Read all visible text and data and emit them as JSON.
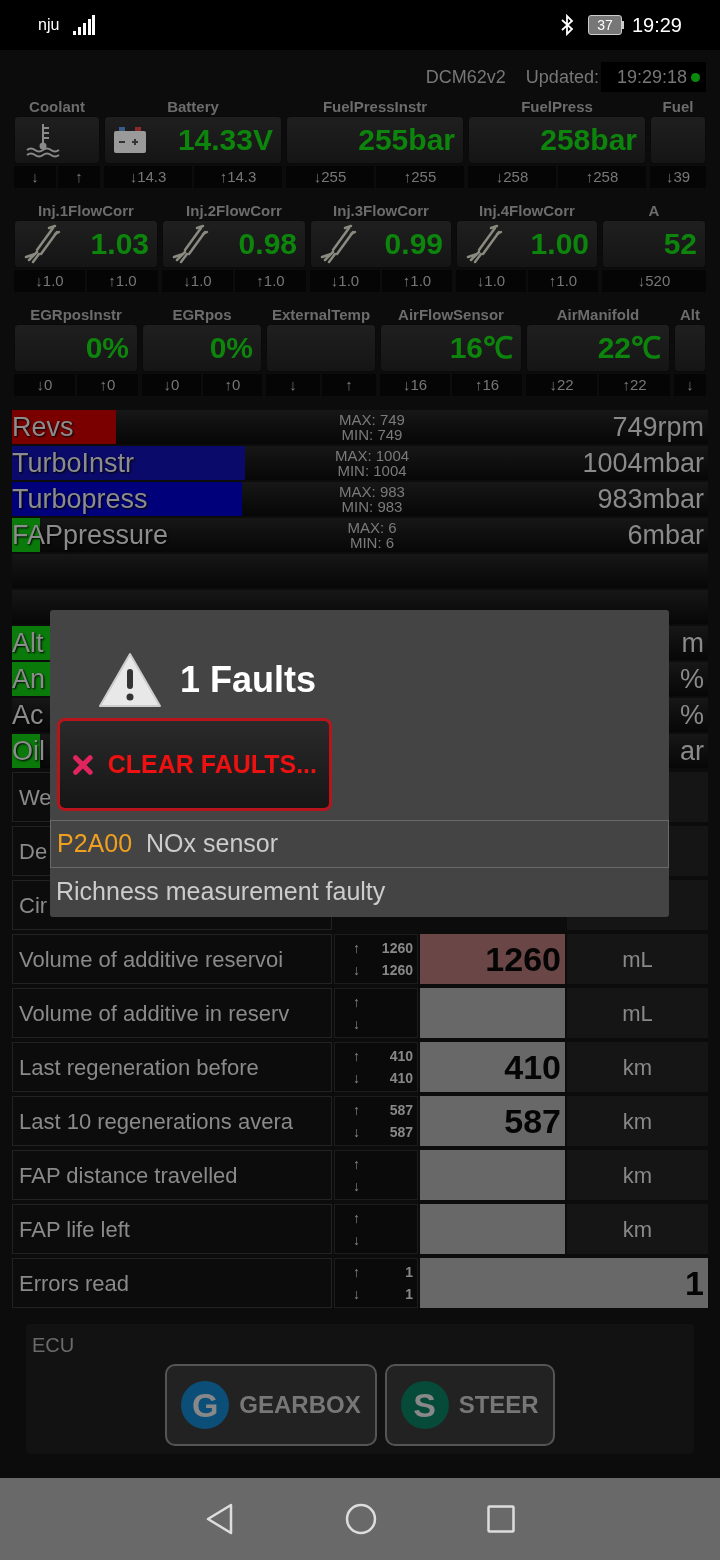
{
  "status_bar": {
    "carrier": "nju",
    "battery": "37",
    "time": "19:29"
  },
  "header": {
    "module": "DCM62v2",
    "updated_label": "Updated:",
    "updated_time": "19:29:18",
    "live": true
  },
  "gauge_rows": [
    {
      "gauges": [
        {
          "label": "Coolant",
          "kind": "thermometer",
          "min": "↓",
          "max": "↑"
        },
        {
          "label": "Battery",
          "kind": "battery",
          "value": "14.33V",
          "min": "↓14.3",
          "max": "↑14.3"
        },
        {
          "label": "FuelPressInstr",
          "value": "255bar",
          "min": "↓255",
          "max": "↑255"
        },
        {
          "label": "FuelPress",
          "value": "258bar",
          "min": "↓258",
          "max": "↑258"
        },
        {
          "label": "Fuel",
          "min": "↓39"
        }
      ]
    },
    {
      "gauges": [
        {
          "label": "Inj.1FlowCorr",
          "kind": "injector",
          "value": "1.03",
          "min": "↓1.0",
          "max": "↑1.0"
        },
        {
          "label": "Inj.2FlowCorr",
          "kind": "injector",
          "value": "0.98",
          "min": "↓1.0",
          "max": "↑1.0"
        },
        {
          "label": "Inj.3FlowCorr",
          "kind": "injector",
          "value": "0.99",
          "min": "↓1.0",
          "max": "↑1.0"
        },
        {
          "label": "Inj.4FlowCorr",
          "kind": "injector",
          "value": "1.00",
          "min": "↓1.0",
          "max": "↑1.0"
        },
        {
          "label": "A",
          "value": "52",
          "min": "↓520"
        }
      ]
    },
    {
      "gauges": [
        {
          "label": "EGRposInstr",
          "value": "0%",
          "min": "↓0",
          "max": "↑0"
        },
        {
          "label": "EGRpos",
          "value": "0%",
          "min": "↓0",
          "max": "↑0"
        },
        {
          "label": "ExternalTemp",
          "min": "↓",
          "max": "↑"
        },
        {
          "label": "AirFlowSensor",
          "value": "16℃",
          "min": "↓16",
          "max": "↑16"
        },
        {
          "label": "AirManifold",
          "value": "22℃",
          "min": "↓22",
          "max": "↑22"
        },
        {
          "label": "Alt",
          "min": "↓"
        }
      ]
    }
  ],
  "bars": [
    {
      "kind": "gauge",
      "label": "Revs",
      "level": 0.15,
      "color": "#7a0000",
      "max": "MAX: 749",
      "min": "MIN: 749",
      "value": "749rpm"
    },
    {
      "kind": "gauge",
      "label": "TurboInstr",
      "level": 0.335,
      "color": "#0a0a6a",
      "max": "MAX: 1004",
      "min": "MIN: 1004",
      "value": "1004mbar"
    },
    {
      "kind": "gauge",
      "label": "Turbopress",
      "level": 0.33,
      "color": "#00007a",
      "max": "MAX: 983",
      "min": "MIN: 983",
      "value": "983mbar"
    },
    {
      "kind": "gauge",
      "label": "FAPpressure",
      "level": 0.04,
      "color": "#0a7a0a",
      "max": "MAX: 6",
      "min": "MIN: 6",
      "value": "6mbar"
    },
    {
      "kind": "empty"
    },
    {
      "kind": "empty"
    },
    {
      "kind": "gauge",
      "label": "Alt",
      "level": 0.1,
      "color": "#0a7a0a",
      "value": "m"
    },
    {
      "kind": "gauge",
      "label": "An",
      "level": 0.1,
      "color": "#0a7a0a",
      "value": "%"
    },
    {
      "kind": "gauge",
      "label": "Ac",
      "value": "%"
    },
    {
      "kind": "gauge",
      "label": "Oil",
      "level": 0.04,
      "color": "#0a7a0a",
      "value": "ar"
    }
  ],
  "table": {
    "rows": [
      {
        "kind": "covered",
        "label": "We"
      },
      {
        "kind": "covered",
        "label": "De"
      },
      {
        "kind": "covered",
        "label": "Cir"
      },
      {
        "kind": "reading",
        "label": "Volume of additive reservoi",
        "up": "↑",
        "max": "1260",
        "down": "↓",
        "min": "1260",
        "value": "1260",
        "unit": "mL",
        "alert": true
      },
      {
        "kind": "reading",
        "label": "Volume of additive in reserv",
        "up": "↑",
        "down": "↓",
        "unit": "mL",
        "alert": false
      },
      {
        "kind": "reading",
        "label": "Last regeneration before",
        "up": "↑",
        "max": "410",
        "down": "↓",
        "min": "410",
        "value": "410",
        "unit": "km",
        "alert": false
      },
      {
        "kind": "reading",
        "label": "Last 10 regenerations avera",
        "up": "↑",
        "max": "587",
        "down": "↓",
        "min": "587",
        "value": "587",
        "unit": "km",
        "alert": false
      },
      {
        "kind": "reading",
        "label": "FAP distance travelled",
        "up": "↑",
        "down": "↓",
        "unit": "km",
        "alert": false
      },
      {
        "kind": "reading",
        "label": "FAP life left",
        "up": "↑",
        "down": "↓",
        "unit": "km",
        "alert": false
      },
      {
        "kind": "count",
        "label": "Errors read",
        "up": "↑",
        "max": "1",
        "down": "↓",
        "min": "1",
        "value": "1",
        "alert": false
      }
    ]
  },
  "ecu": {
    "label": "ECU",
    "buttons": [
      {
        "badge": "G",
        "label": "GEARBOX",
        "color": "#0b4f78"
      },
      {
        "badge": "S",
        "label": "STEER",
        "color": "#064a3a"
      }
    ]
  },
  "dialog": {
    "title": "1 Faults",
    "clear_button": "CLEAR FAULTS...",
    "faults": [
      {
        "code": "P2A00",
        "name": "NOx sensor",
        "description": "Richness measurement faulty"
      }
    ]
  }
}
